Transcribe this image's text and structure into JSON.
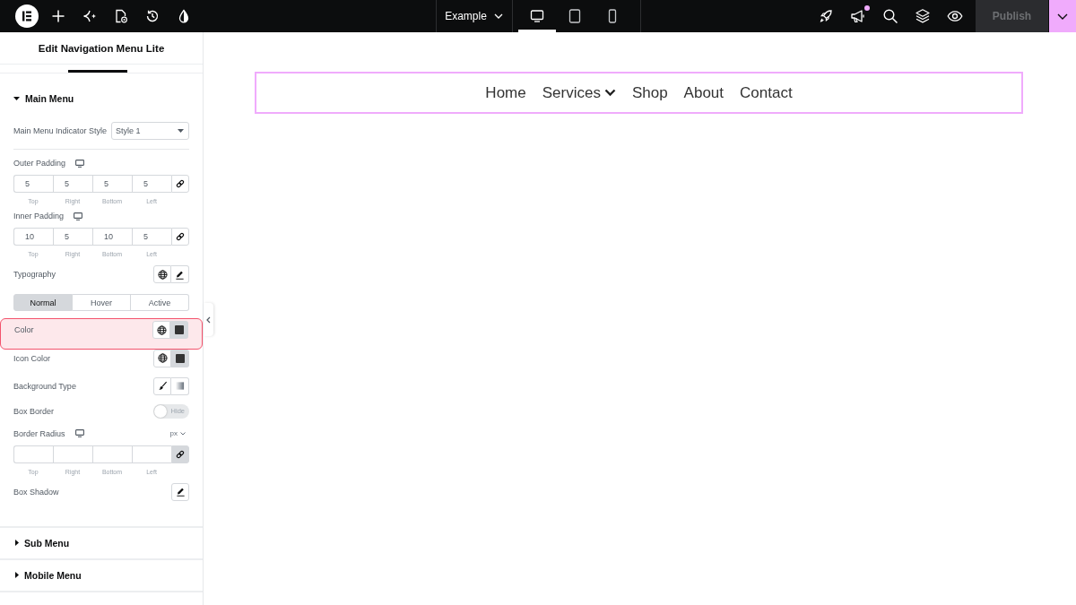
{
  "top_bar": {
    "document_title": "Example",
    "devices": [
      {
        "kind": "desktop",
        "selected": true
      },
      {
        "kind": "tablet",
        "selected": false
      },
      {
        "kind": "mobile",
        "selected": false
      }
    ],
    "notification_unread": true,
    "publish": {
      "label": "Publish",
      "disabled": true
    }
  },
  "panel": {
    "title": "Edit Navigation Menu Lite",
    "sections": [
      {
        "title": "Main Menu",
        "expanded": true,
        "controls": [
          {
            "kind": "select",
            "label": "Main Menu Indicator Style",
            "value": "Style 1",
            "separator": true
          },
          {
            "kind": "dimensions",
            "label": "Outer Padding",
            "responsive": true,
            "linked": false,
            "fields": [
              {
                "sublabel": "Top",
                "value": "5"
              },
              {
                "sublabel": "Right",
                "value": "5"
              },
              {
                "sublabel": "Bottom",
                "value": "5"
              },
              {
                "sublabel": "Left",
                "value": "5"
              }
            ]
          },
          {
            "kind": "dimensions",
            "label": "Inner Padding",
            "responsive": true,
            "linked": false,
            "fields": [
              {
                "sublabel": "Top",
                "value": "10"
              },
              {
                "sublabel": "Right",
                "value": "5"
              },
              {
                "sublabel": "Bottom",
                "value": "10"
              },
              {
                "sublabel": "Left",
                "value": "5"
              }
            ]
          },
          {
            "kind": "popover",
            "label": "Typography",
            "global": true
          },
          {
            "kind": "tabs",
            "tabs": [
              {
                "label": "Normal",
                "selected": true
              },
              {
                "label": "Hover",
                "selected": false
              },
              {
                "label": "Active",
                "selected": false
              }
            ]
          },
          {
            "kind": "color",
            "label": "Color",
            "highlighted": true,
            "color": "#333333"
          },
          {
            "kind": "color",
            "label": "Icon Color",
            "highlighted": false,
            "color": "#333333"
          },
          {
            "kind": "background",
            "label": "Background Type"
          },
          {
            "kind": "switch",
            "label": "Box Border",
            "on": false,
            "off_label": "Hide"
          },
          {
            "kind": "dimensions",
            "label": "Border Radius",
            "responsive": true,
            "unit": "px",
            "linked": true,
            "fields": [
              {
                "sublabel": "Top"
              },
              {
                "sublabel": "Right"
              },
              {
                "sublabel": "Bottom"
              },
              {
                "sublabel": "Left"
              }
            ]
          },
          {
            "kind": "popover",
            "label": "Box Shadow",
            "global": false
          }
        ]
      },
      {
        "title": "Sub Menu",
        "expanded": false
      },
      {
        "title": "Mobile Menu",
        "expanded": false
      }
    ]
  },
  "canvas": {
    "menu_items": [
      {
        "label": "Home",
        "has_submenu": false
      },
      {
        "label": "Services",
        "has_submenu": true
      },
      {
        "label": "Shop",
        "has_submenu": false
      },
      {
        "label": "About",
        "has_submenu": false
      },
      {
        "label": "Contact",
        "has_submenu": false
      }
    ]
  }
}
